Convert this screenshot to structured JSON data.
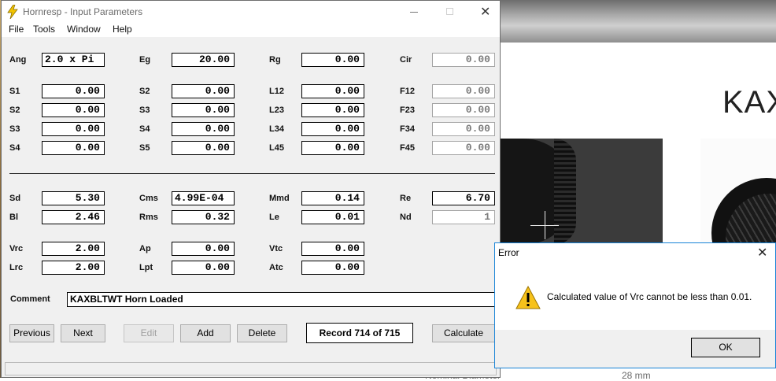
{
  "background": {
    "heading": "KAX",
    "footer_text": "Nominal Diameter",
    "footer_value": "28 mm"
  },
  "window": {
    "title": "Hornresp - Input Parameters",
    "menu": [
      "File",
      "Tools",
      "Window",
      "Help"
    ]
  },
  "fields": {
    "row0": [
      {
        "label": "Ang",
        "value": "2.0 x Pi"
      },
      {
        "label": "Eg",
        "value": "20.00"
      },
      {
        "label": "Rg",
        "value": "0.00"
      },
      {
        "label": "Cir",
        "value": "0.00"
      }
    ],
    "row1": [
      {
        "label": "S1",
        "value": "0.00"
      },
      {
        "label": "S2",
        "value": "0.00"
      },
      {
        "label": "L12",
        "value": "0.00"
      },
      {
        "label": "F12",
        "value": "0.00"
      }
    ],
    "row2": [
      {
        "label": "S2",
        "value": "0.00"
      },
      {
        "label": "S3",
        "value": "0.00"
      },
      {
        "label": "L23",
        "value": "0.00"
      },
      {
        "label": "F23",
        "value": "0.00"
      }
    ],
    "row3": [
      {
        "label": "S3",
        "value": "0.00"
      },
      {
        "label": "S4",
        "value": "0.00"
      },
      {
        "label": "L34",
        "value": "0.00"
      },
      {
        "label": "F34",
        "value": "0.00"
      }
    ],
    "row4": [
      {
        "label": "S4",
        "value": "0.00"
      },
      {
        "label": "S5",
        "value": "0.00"
      },
      {
        "label": "L45",
        "value": "0.00"
      },
      {
        "label": "F45",
        "value": "0.00"
      }
    ],
    "row5": [
      {
        "label": "Sd",
        "value": "5.30"
      },
      {
        "label": "Cms",
        "value": "4.99E-04"
      },
      {
        "label": "Mmd",
        "value": "0.14"
      },
      {
        "label": "Re",
        "value": "6.70"
      }
    ],
    "row6": [
      {
        "label": "Bl",
        "value": "2.46"
      },
      {
        "label": "Rms",
        "value": "0.32"
      },
      {
        "label": "Le",
        "value": "0.01"
      },
      {
        "label": "Nd",
        "value": "1"
      }
    ],
    "row7": [
      {
        "label": "Vrc",
        "value": "2.00"
      },
      {
        "label": "Ap",
        "value": "0.00"
      },
      {
        "label": "Vtc",
        "value": "0.00"
      }
    ],
    "row8": [
      {
        "label": "Lrc",
        "value": "2.00"
      },
      {
        "label": "Lpt",
        "value": "0.00"
      },
      {
        "label": "Atc",
        "value": "0.00"
      }
    ]
  },
  "comment": {
    "label": "Comment",
    "value": "KAXBLTWT Horn Loaded"
  },
  "buttons": {
    "previous": "Previous",
    "next": "Next",
    "edit": "Edit",
    "add": "Add",
    "delete": "Delete",
    "record": "Record 714 of 715",
    "calculate": "Calculate"
  },
  "error_dialog": {
    "title": "Error",
    "message": "Calculated value of Vrc cannot be less than 0.01.",
    "ok": "OK",
    "icon": "warning-icon"
  }
}
